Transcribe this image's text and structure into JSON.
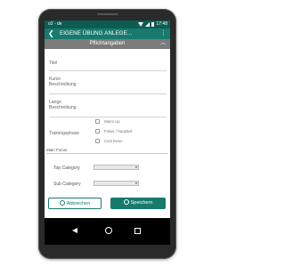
{
  "status_bar": {
    "left_text": "o2 - de",
    "time": "17:48"
  },
  "app_bar": {
    "title": "EIGENE ÜBUNG ANLEGE...",
    "back_glyph": "❮",
    "more_glyph": "⋮"
  },
  "section": {
    "label": "Pflichtangaben",
    "chevron_glyph": "︿"
  },
  "fields": {
    "titel": "Titel",
    "kurze_line1": "Kurze",
    "kurze_line2": "Beschreibung",
    "lange_line1": "Lange",
    "lange_line2": "Beschreibung"
  },
  "trainingsphase": {
    "label": "Trainingsphase",
    "options": [
      "Warm Up",
      "Fokus / Hauptteil",
      "Cool Down"
    ]
  },
  "main_focus": {
    "label": "Main Focus",
    "top_category_label": "Top Category",
    "sub_category_label": "Sub Category"
  },
  "buttons": {
    "cancel": "Abbrechen",
    "save": "Speichern"
  },
  "colors": {
    "status_bar": "#0d5c52",
    "app_bar": "#187a6d",
    "section": "#7b7b7b"
  }
}
